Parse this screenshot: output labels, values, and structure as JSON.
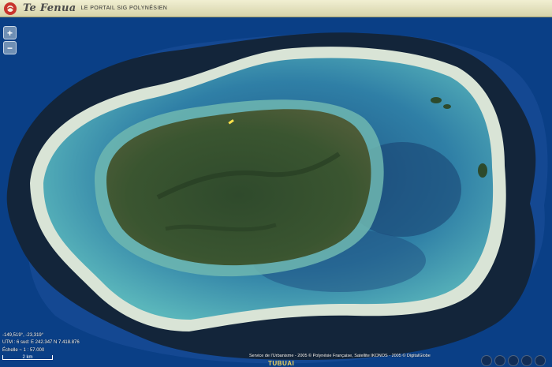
{
  "header": {
    "brand": "Te Fenua",
    "tagline": "LE PORTAIL SIG POLYNÉSIEN"
  },
  "controls": {
    "zoom_in": "+",
    "zoom_out": "−"
  },
  "status": {
    "coordinates": "-149,519°, -23,319°",
    "utm": "UTM : 6 sud: E 242.347 N 7.418.876",
    "scale": "Échelle ~ 1 : 57.000",
    "scale_bar_label": "2 km"
  },
  "attribution": "Service de l'Urbanisme - 2005 © Polynésie Française, Satellite IKONOS - 2005 © DigitalGlobe",
  "place_label": "TUBUAI",
  "colors": {
    "ocean_deep": "#0a3f86",
    "ocean_shelf": "#1b4f9b",
    "reef_dark": "#13253a",
    "reef_crest": "#d9e4d6",
    "lagoon_shallow": "#4fa7b5",
    "lagoon_deep": "#1f5a86",
    "island_green": "#2e4a2a",
    "header_bg": "#e8e6c4",
    "label_yellow": "#f2d45c"
  }
}
